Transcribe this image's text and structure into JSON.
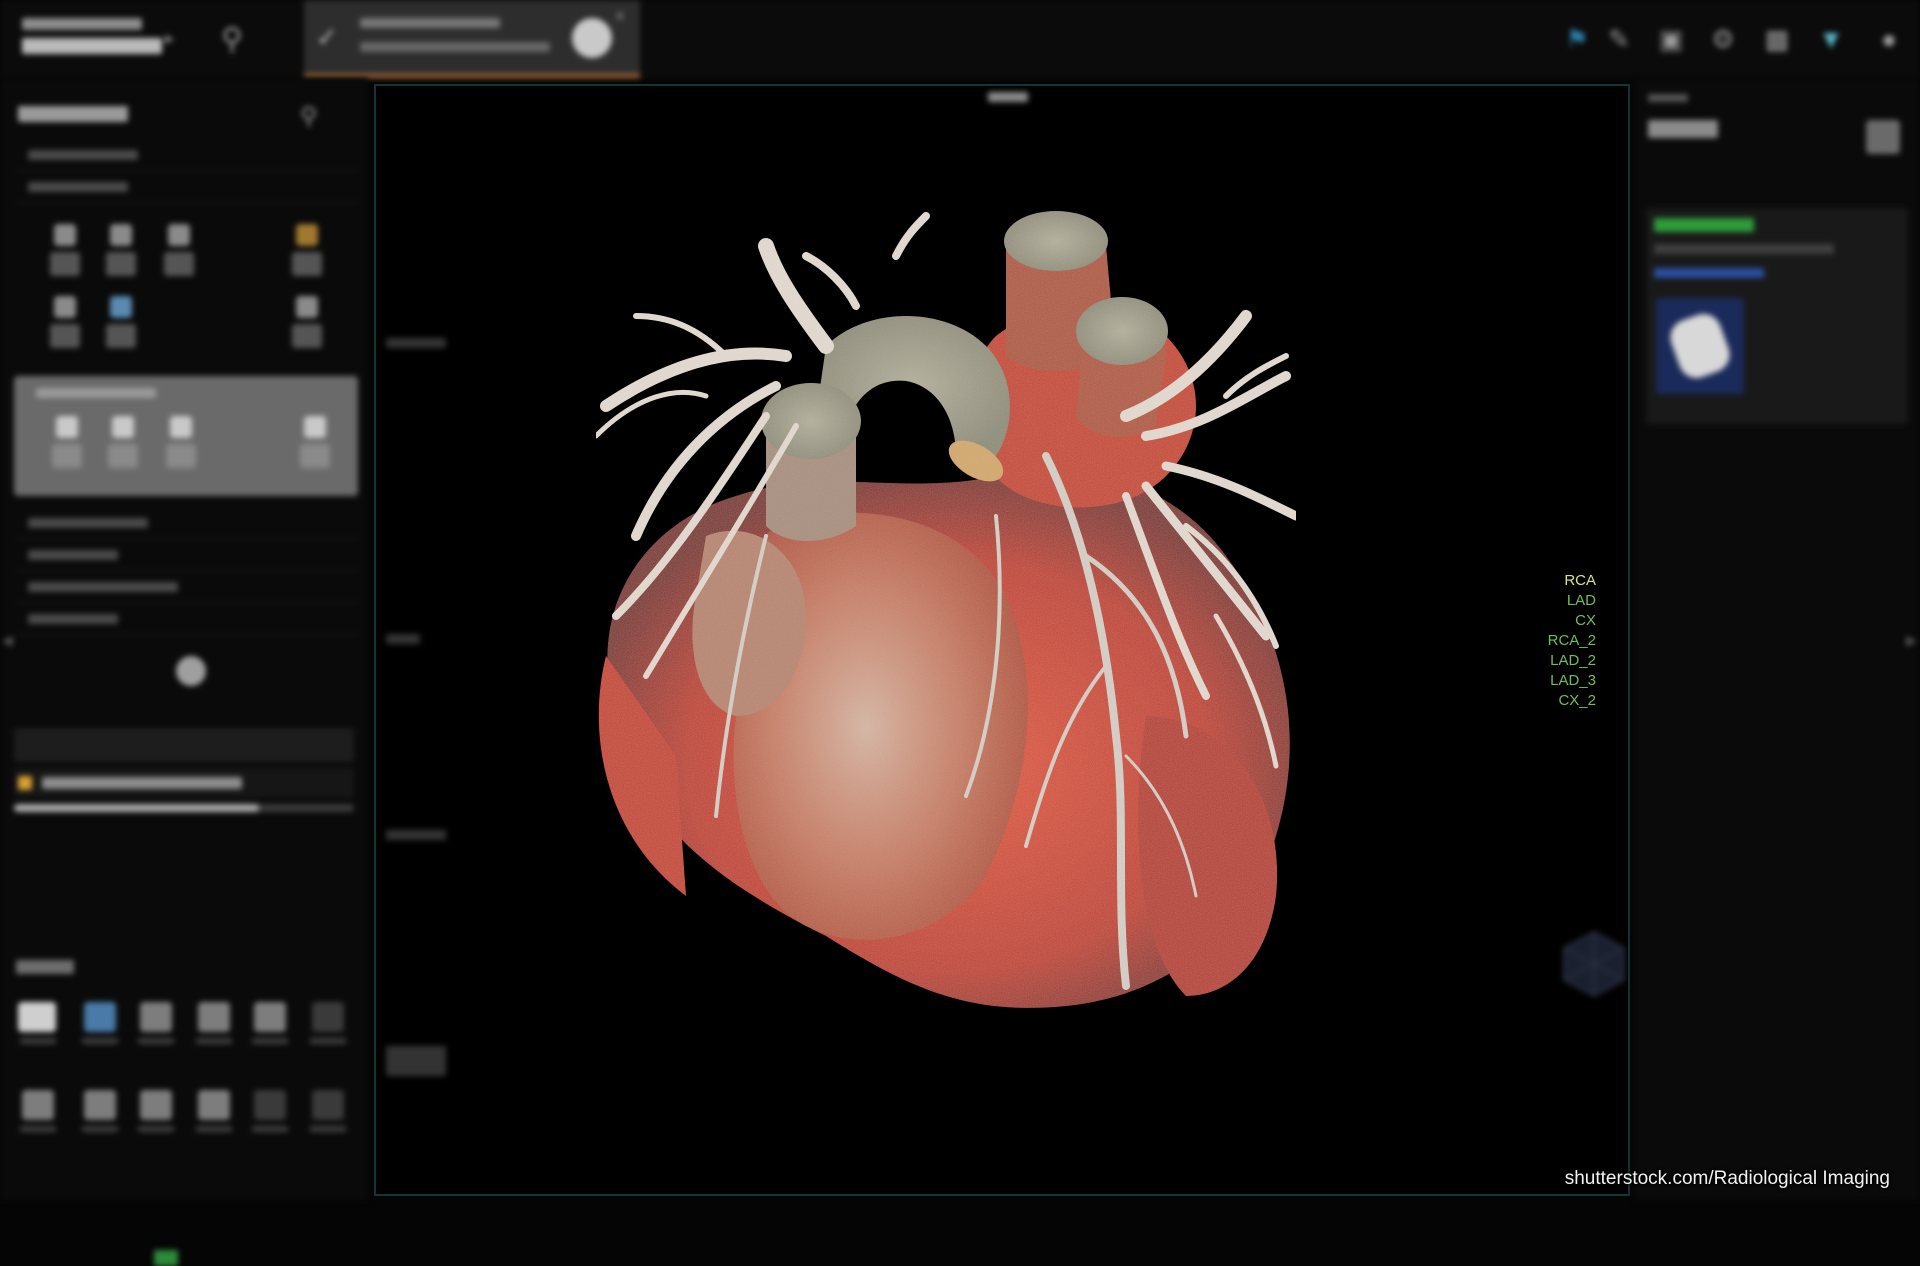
{
  "app": {
    "colors": {
      "background": "#050505",
      "tab_accent": "#b06b32",
      "viewer_border": "#143436",
      "vessel_label_green": "#6fbf5a",
      "vessel_label_yellow": "#e0e08a",
      "findings_marker": "#d8a030",
      "status_green": "#2f9a3b",
      "myocardium_red": "#d43a12"
    }
  },
  "viewer": {
    "vessel_labels": [
      {
        "label": "RCA",
        "color": "#e0e08a"
      },
      {
        "label": "LAD",
        "color": "#6fbf5a"
      },
      {
        "label": "CX",
        "color": "#6fbf5a"
      },
      {
        "label": "RCA_2",
        "color": "#6fbf5a"
      },
      {
        "label": "LAD_2",
        "color": "#6fbf5a"
      },
      {
        "label": "LAD_3",
        "color": "#6fbf5a"
      },
      {
        "label": "CX_2",
        "color": "#6fbf5a"
      }
    ]
  },
  "icons": {
    "search": "search-icon",
    "chevron": "chevron-right-icon",
    "close": "close-icon",
    "orientation": "orientation-cube-icon"
  },
  "watermark": "shutterstock.com/Radiological Imaging"
}
